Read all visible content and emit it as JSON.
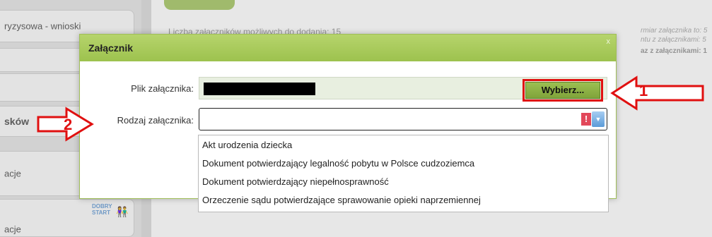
{
  "sidebar": {
    "items": [
      {
        "label": "ryzysowa - wnioski"
      },
      {
        "label": ""
      },
      {
        "label": ""
      },
      {
        "label": "sków"
      },
      {
        "label": "acje"
      },
      {
        "label": "acje"
      }
    ],
    "logo_text": "DOBRY START"
  },
  "background": {
    "attachments_text": "Liczba załączników możliwych do dodania: 15",
    "right_note_1": "rmiar załącznika to: 5",
    "right_note_2": "ntu z załącznikami: 5",
    "right_note_3": "az z załącznikami: 1"
  },
  "dialog": {
    "title": "Załącznik",
    "close_label": "x",
    "file_label": "Plik załącznika:",
    "choose_button": "Wybierz...",
    "type_label": "Rodzaj załącznika:",
    "type_value": "",
    "warning_symbol": "!",
    "dropdown_symbol": "▼",
    "options": [
      "Akt urodzenia dziecka",
      "Dokument potwierdzający legalność pobytu w Polsce cudzoziemca",
      "Dokument potwierdzający niepełnosprawność",
      "Orzeczenie sądu potwierdzające sprawowanie opieki naprzemiennej"
    ]
  },
  "annotations": {
    "step1": "1",
    "step2": "2",
    "color": "#e01010"
  }
}
